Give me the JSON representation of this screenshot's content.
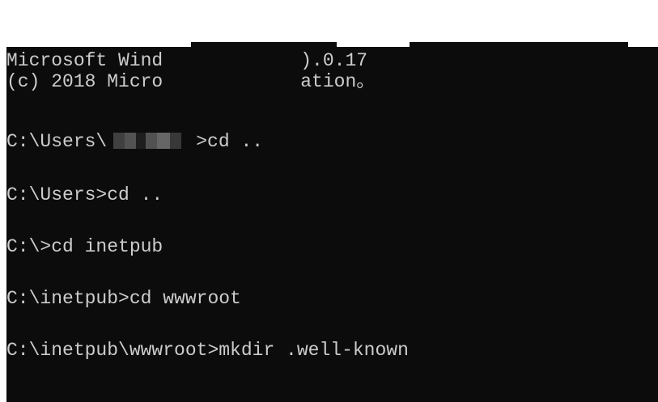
{
  "terminal": {
    "lines": {
      "header_left_1": "Microsoft Wind",
      "header_right_1": ").0.17",
      "header_left_2": "(c) 2018 Micro",
      "header_right_2": "ation。",
      "prompt_users_prefix": "C:\\Users\\",
      "prompt_users_suffix": ">cd ..",
      "prompt_users_2": "C:\\Users>cd ..",
      "prompt_root": "C:\\>cd inetpub",
      "prompt_inetpub": "C:\\inetpub>cd wwwroot",
      "prompt_wwwroot": "C:\\inetpub\\wwwroot>mkdir .well-known"
    }
  }
}
